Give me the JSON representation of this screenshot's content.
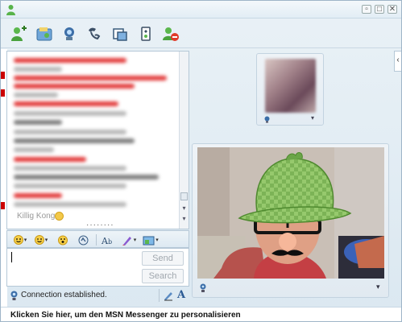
{
  "window": {
    "title": "",
    "controls": [
      "restore",
      "maximize",
      "close"
    ]
  },
  "toolbar": {
    "buttons": [
      {
        "name": "invite-icon"
      },
      {
        "name": "send-files-icon"
      },
      {
        "name": "webcam-icon"
      },
      {
        "name": "call-icon"
      },
      {
        "name": "activities-icon"
      },
      {
        "name": "games-icon"
      },
      {
        "name": "block-icon"
      }
    ]
  },
  "conversation": {
    "last_sender": "Killig Kong"
  },
  "format_bar": {
    "font_label": "A",
    "items": [
      "emoticon-icon",
      "wink-icon",
      "voice-clip-icon",
      "nudge-icon",
      "font-icon",
      "color-icon",
      "background-icon"
    ]
  },
  "input": {
    "value": "",
    "send_label": "Send",
    "search_label": "Search"
  },
  "status": {
    "text": "Connection established."
  },
  "footer": {
    "text": "Klicken Sie hier, um den MSN Messenger zu personalisieren"
  }
}
